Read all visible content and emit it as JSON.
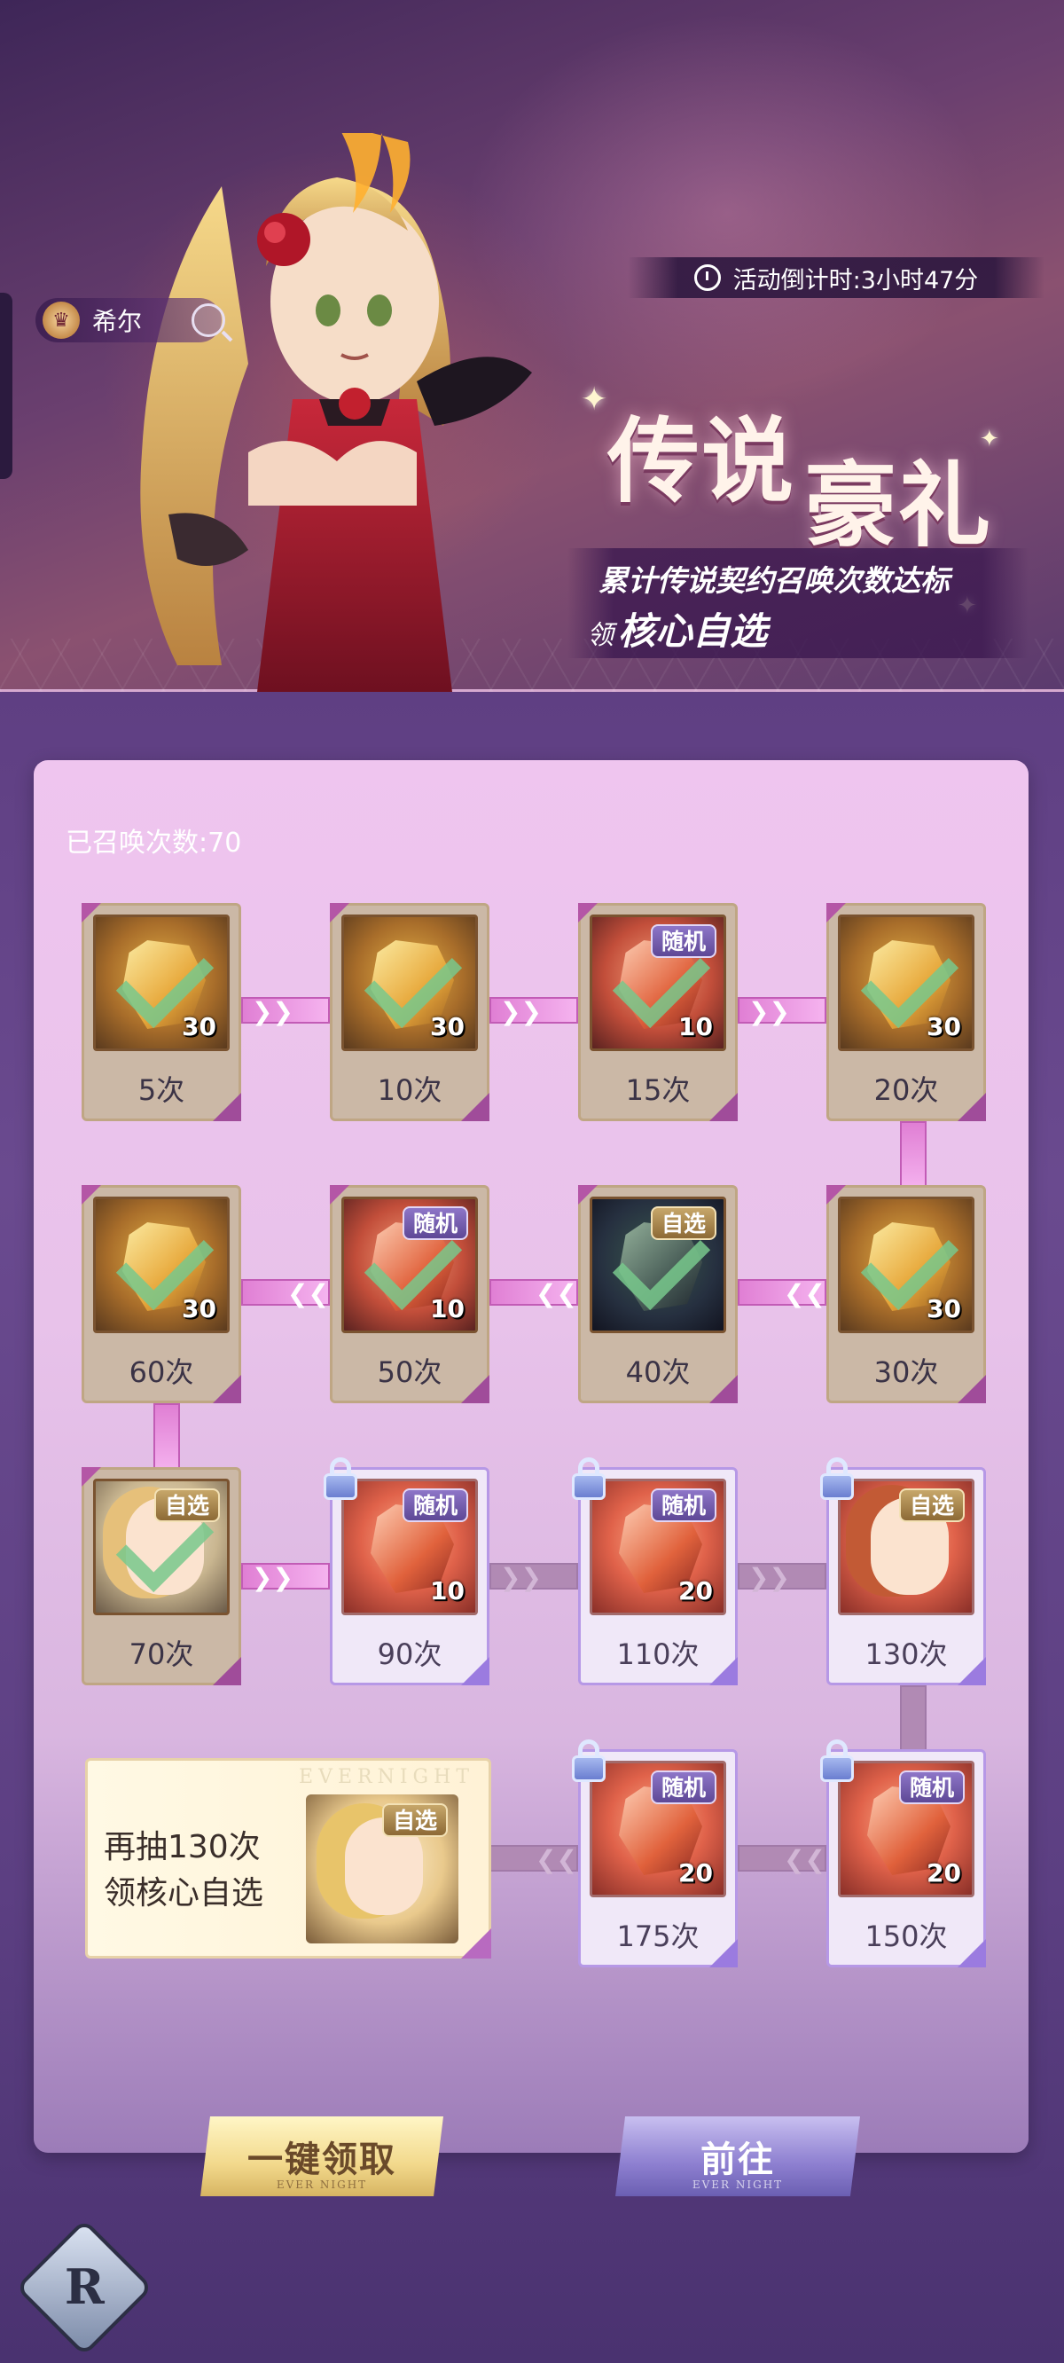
{
  "header": {
    "character_name": "希尔",
    "countdown": "活动倒计时:3小时47分",
    "title_part1": "传说",
    "title_part2": "豪礼",
    "subtitle_line1": "累计传说契约召唤次数达标",
    "subtitle_line2_prefix": "领",
    "subtitle_line2_main": "核心自选"
  },
  "summon_count_label": "已召唤次数:70",
  "tag_labels": {
    "random": "随机",
    "pick": "自选"
  },
  "milestones": [
    {
      "label": "5次",
      "qty": "30",
      "claimed": true
    },
    {
      "label": "10次",
      "qty": "30",
      "claimed": true
    },
    {
      "label": "15次",
      "qty": "10",
      "tag": "随机",
      "claimed": true
    },
    {
      "label": "20次",
      "qty": "30",
      "claimed": true
    },
    {
      "label": "30次",
      "qty": "30",
      "claimed": true
    },
    {
      "label": "40次",
      "tag": "自选",
      "claimed": true
    },
    {
      "label": "50次",
      "qty": "10",
      "tag": "随机",
      "claimed": true
    },
    {
      "label": "60次",
      "qty": "30",
      "claimed": true
    },
    {
      "label": "70次",
      "tag": "自选",
      "claimed": true
    },
    {
      "label": "90次",
      "qty": "10",
      "tag": "随机",
      "locked": true
    },
    {
      "label": "110次",
      "qty": "20",
      "tag": "随机",
      "locked": true
    },
    {
      "label": "130次",
      "tag": "自选",
      "locked": true
    },
    {
      "label": "150次",
      "qty": "20",
      "tag": "随机",
      "locked": true
    },
    {
      "label": "175次",
      "qty": "20",
      "tag": "随机",
      "locked": true
    }
  ],
  "final_reward": {
    "watermark": "EVERNIGHT",
    "line1": "再抽130次",
    "line2": "领核心自选",
    "tag": "自选"
  },
  "buttons": {
    "claim_all": "一键领取",
    "claim_sub": "EVER NIGHT",
    "go": "前往",
    "go_sub": "EVER NIGHT"
  },
  "colors": {
    "claimed_connector": "#e07fd4",
    "locked_connector": "#b18ab4",
    "random_tag": "#7a62b4",
    "pick_tag": "#a9874e"
  }
}
